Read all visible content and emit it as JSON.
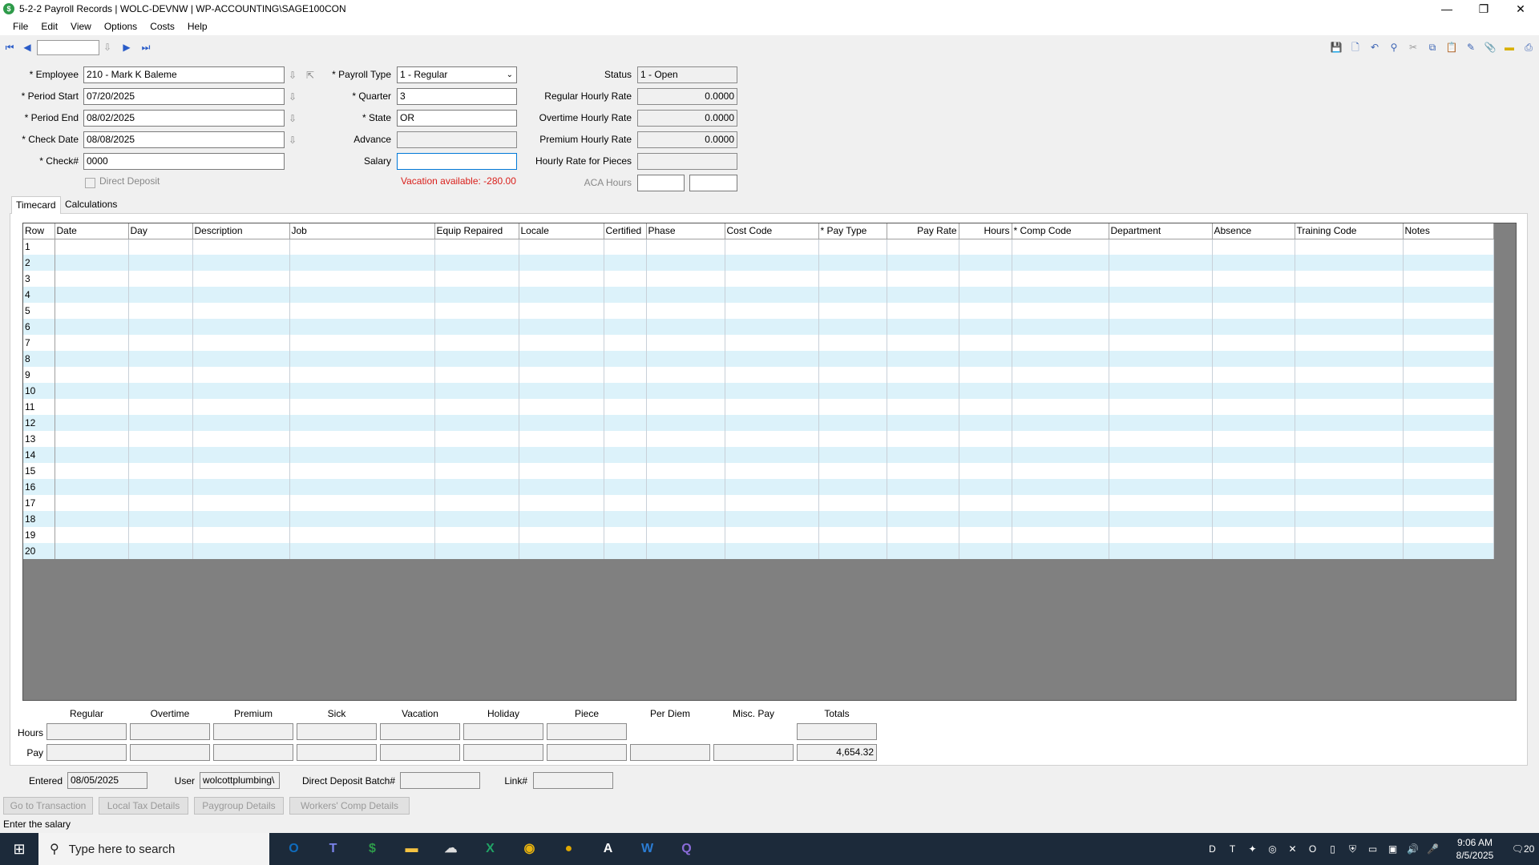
{
  "window": {
    "title": "5-2-2 Payroll Records  |  WOLC-DEVNW  |  WP-ACCOUNTING\\SAGE100CON",
    "minimize": "—",
    "restore": "❐",
    "close": "✕"
  },
  "menu": [
    "File",
    "Edit",
    "View",
    "Options",
    "Costs",
    "Help"
  ],
  "form": {
    "employee_label": "* Employee",
    "employee_value": "210 - Mark K Baleme",
    "period_start_label": "* Period Start",
    "period_start_value": "07/20/2025",
    "period_end_label": "* Period End",
    "period_end_value": "08/02/2025",
    "check_date_label": "* Check Date",
    "check_date_value": "08/08/2025",
    "check_label": "* Check#",
    "check_value": "0000",
    "direct_deposit_label": "Direct Deposit",
    "payroll_type_label": "* Payroll Type",
    "payroll_type_value": "1 - Regular",
    "quarter_label": "* Quarter",
    "quarter_value": "3",
    "state_label": "* State",
    "state_value": "OR",
    "advance_label": "Advance",
    "advance_value": "",
    "salary_label": "Salary",
    "salary_value": "",
    "vacation_text": "Vacation available:  -280.00",
    "status_label": "Status",
    "status_value": "1 - Open",
    "regular_rate_label": "Regular Hourly Rate",
    "regular_rate_value": "0.0000",
    "overtime_rate_label": "Overtime Hourly Rate",
    "overtime_rate_value": "0.0000",
    "premium_rate_label": "Premium Hourly Rate",
    "premium_rate_value": "0.0000",
    "pieces_rate_label": "Hourly Rate for Pieces",
    "pieces_rate_value": "",
    "aca_label": "ACA Hours",
    "aca_value_1": "",
    "aca_value_2": ""
  },
  "tabs": [
    "Timecard",
    "Calculations"
  ],
  "grid": {
    "columns": [
      "Row",
      "Date",
      "Day",
      "Description",
      "Job",
      "Equip Repaired",
      "Locale",
      "Certified",
      "Phase",
      "Cost Code",
      "* Pay Type",
      "Pay Rate",
      "Hours",
      "* Comp Code",
      "Department",
      "Absence",
      "Training Code",
      "Notes"
    ],
    "rows": [
      "1",
      "2",
      "3",
      "4",
      "5",
      "6",
      "7",
      "8",
      "9",
      "10",
      "11",
      "12",
      "13",
      "14",
      "15",
      "16",
      "17",
      "18",
      "19",
      "20"
    ]
  },
  "totals": {
    "headers": [
      "Regular",
      "Overtime",
      "Premium",
      "Sick",
      "Vacation",
      "Holiday",
      "Piece",
      "Per Diem",
      "Misc. Pay",
      "Totals"
    ],
    "hours_label": "Hours",
    "pay_label": "Pay",
    "pay_total": "4,654.32"
  },
  "footer": {
    "entered_label": "Entered",
    "entered_value": "08/05/2025",
    "user_label": "User",
    "user_value": "wolcottplumbing\\",
    "dd_batch_label": "Direct Deposit Batch#",
    "dd_batch_value": "",
    "link_label": "Link#",
    "link_value": ""
  },
  "buttons": [
    "Go to Transaction",
    "Local Tax Details",
    "Paygroup Details",
    "Workers' Comp Details"
  ],
  "status_text": "Enter the salary",
  "taskbar": {
    "search_placeholder": "Type here to search",
    "time": "9:06 AM",
    "date": "8/5/2025",
    "notifications": "20"
  }
}
